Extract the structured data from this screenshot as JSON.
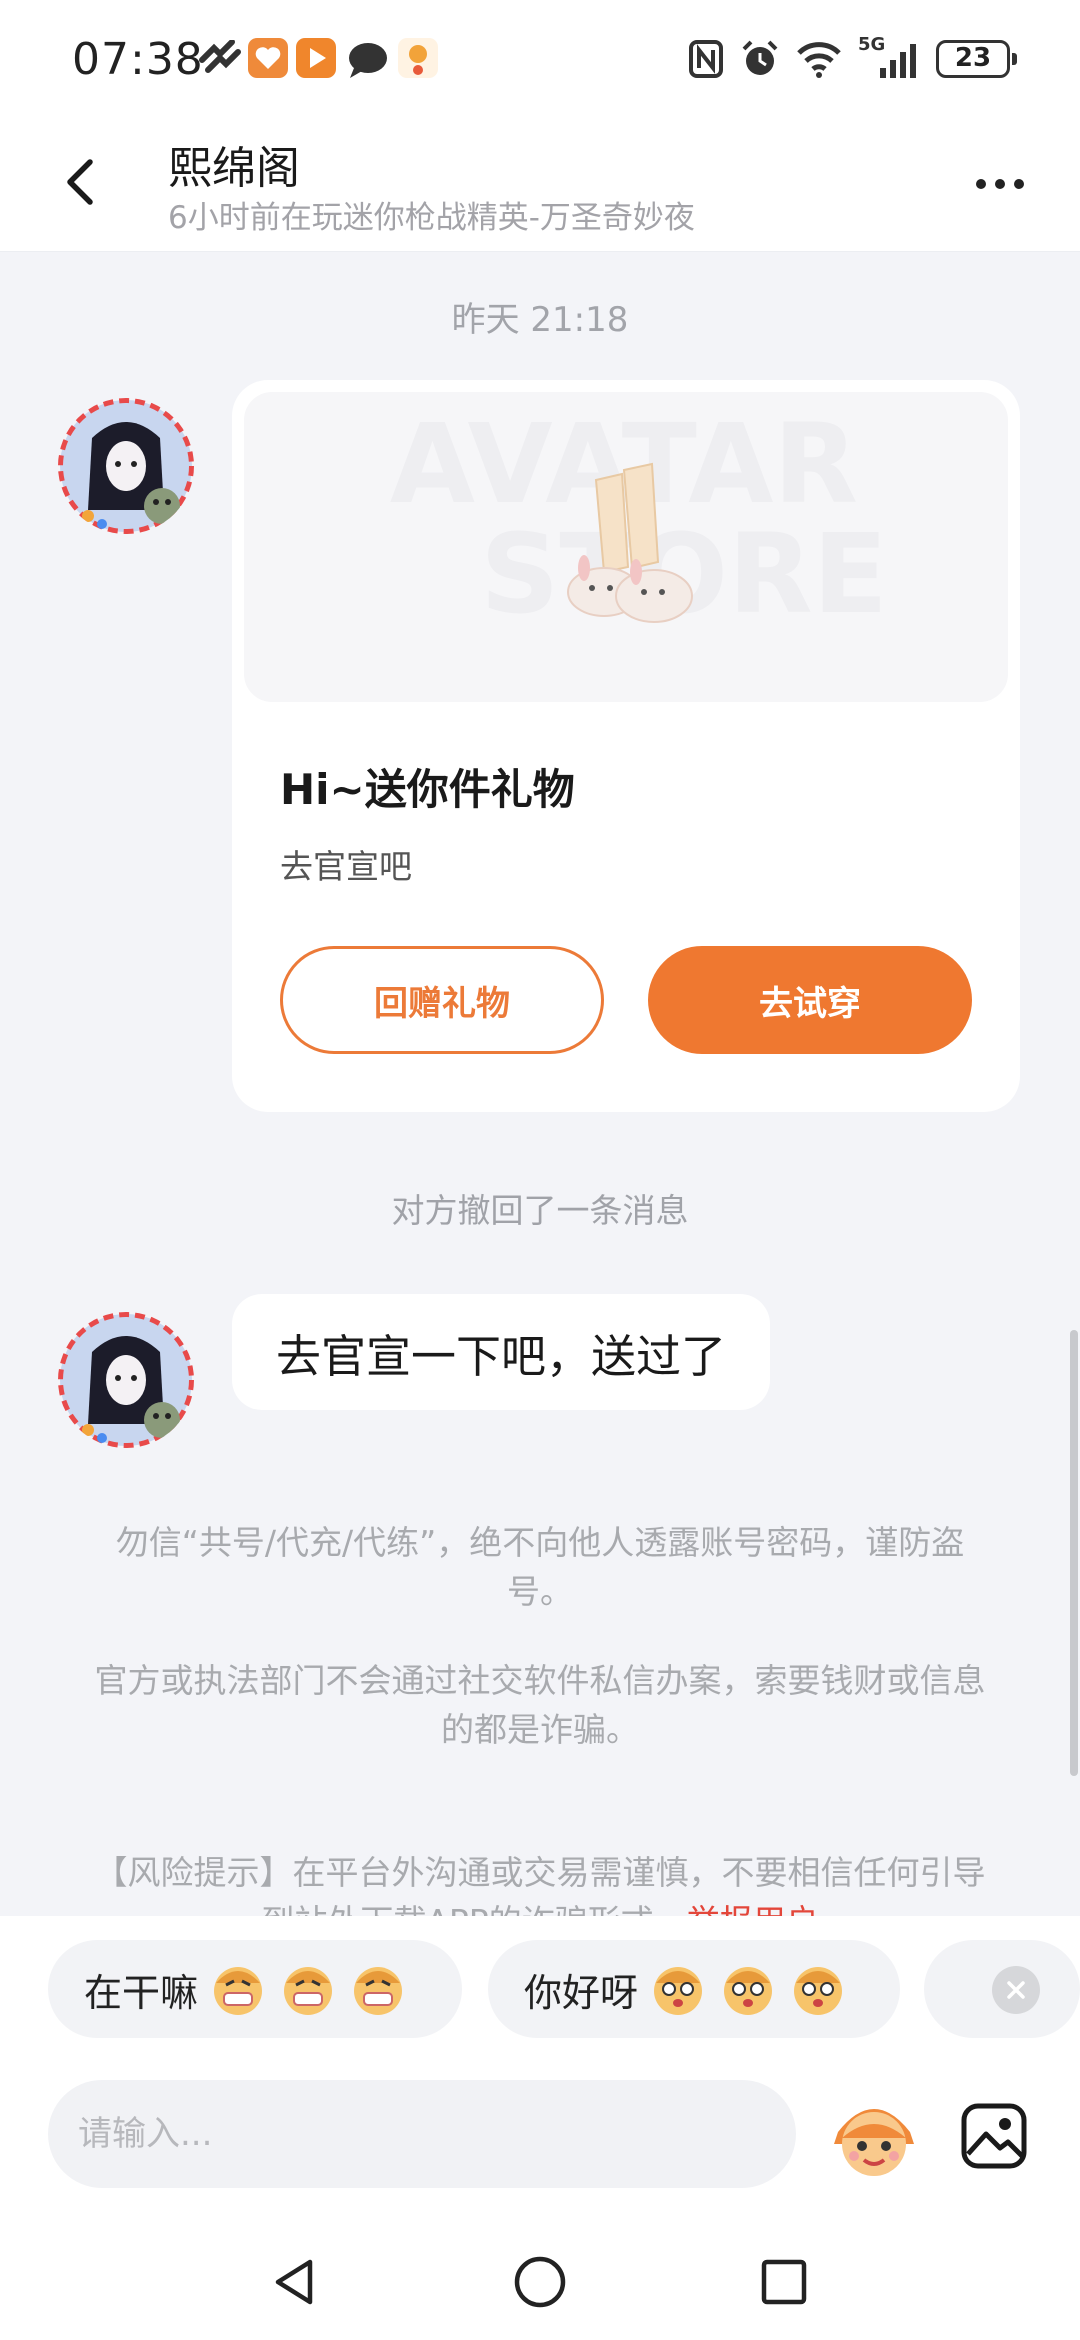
{
  "status_bar": {
    "time": "07:38",
    "battery": "23",
    "network": "5G"
  },
  "header": {
    "title": "熙绵阁",
    "subtitle": "6小时前在玩迷你枪战精英-万圣奇妙夜"
  },
  "chat": {
    "timestamp": "昨天 21:18",
    "gift_card": {
      "image_text_top": "AVATAR",
      "image_text_bottom": "STORE",
      "title": "Hi~送你件礼物",
      "subtitle": "去官宣吧",
      "return_gift_label": "回赠礼物",
      "try_on_label": "去试穿"
    },
    "recall_notice": "对方撤回了一条消息",
    "message": "去官宣一下吧，送过了",
    "notices": [
      "勿信“共号/代充/代练”，绝不向他人透露账号密码，谨防盗号。",
      "官方或执法部门不会通过社交软件私信办案，索要钱财或信息的都是诈骗。"
    ],
    "risk_notice": {
      "text": "【风险提示】在平台外沟通或交易需谨慎，不要相信任何引导到站外下载APP的诈骗形式，",
      "link": "举报用户"
    }
  },
  "quick_replies": [
    {
      "text": "在干嘛"
    },
    {
      "text": "你好呀"
    },
    {
      "text": ""
    }
  ],
  "input": {
    "placeholder": "请输入..."
  },
  "colors": {
    "accent": "#ef7830",
    "background": "#f3f4f8"
  }
}
